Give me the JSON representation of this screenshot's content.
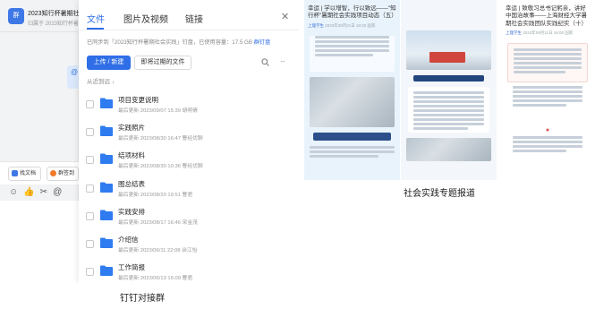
{
  "chat": {
    "title": "2023知行杯暑期社",
    "subtitle": "归属于 2023知行杯暑期",
    "avatar_text": "群",
    "at_symbol": "@",
    "buttons": [
      {
        "label": "找文档",
        "color": "#3e78e6"
      },
      {
        "label": "群签到",
        "color": "#f07a2a"
      }
    ],
    "emoji_icons": [
      "emoji-icon",
      "thumbs-up-icon",
      "scissors-icon",
      "at-icon"
    ]
  },
  "file_panel": {
    "tabs": [
      "文件",
      "图片及视频",
      "链接"
    ],
    "active_tab": 0,
    "quota_text": "已同步到「2023知行杯暑期社会实践」钉盘，已使用容量：17.5 GB",
    "quota_link": "群钉盘",
    "upload_label": "上传 / 新建",
    "expired_label": "即将过期的文件",
    "sort_label": "从近到远 ↓",
    "files": [
      {
        "name": "项目变更说明",
        "meta": "最后更新 2023/09/07 15:39  胡明倩"
      },
      {
        "name": "实践照片",
        "meta": "最后更新 2023/08/30 16:47  曹经优聊"
      },
      {
        "name": "结项材料",
        "meta": "最后更新 2023/08/30 10:36  曹经优聊"
      },
      {
        "name": "图总结表",
        "meta": "最后更新 2023/08/20 19:51  曹君"
      },
      {
        "name": "实践安排",
        "meta": "最后更新 2023/08/17 16:46  宋金茂"
      },
      {
        "name": "介绍信",
        "meta": "最后更新 2023/06/11 22:08  余江怡"
      },
      {
        "name": "工作简报",
        "meta": "最后更新 2023/06/13 15:09  曹君"
      }
    ],
    "folder_color": "#2f7bf0"
  },
  "captions": {
    "left": "钉钉对接群",
    "right": "社会实践专题报道"
  },
  "articles": [
    {
      "title": "幸运 | 学以增智，行以致远——\"知行杯\"暑期社会实践项目动态（五）",
      "source": "上理学生",
      "date": "2023年08月21日 18:00  国家"
    },
    {
      "title": "",
      "source": "",
      "date": ""
    },
    {
      "title": "幸运 | 致敬习总书记躬亲，讲好中国治故事——上海财经大学暑期社会实践团队实践纪实（十）",
      "source": "上理学生",
      "date": "2023年09月11日 18:00  国家"
    }
  ],
  "art1_banner": "不忘初心牢记使命",
  "art2_banner": "走近前辈感悟初心使命",
  "art3_mark": "●"
}
